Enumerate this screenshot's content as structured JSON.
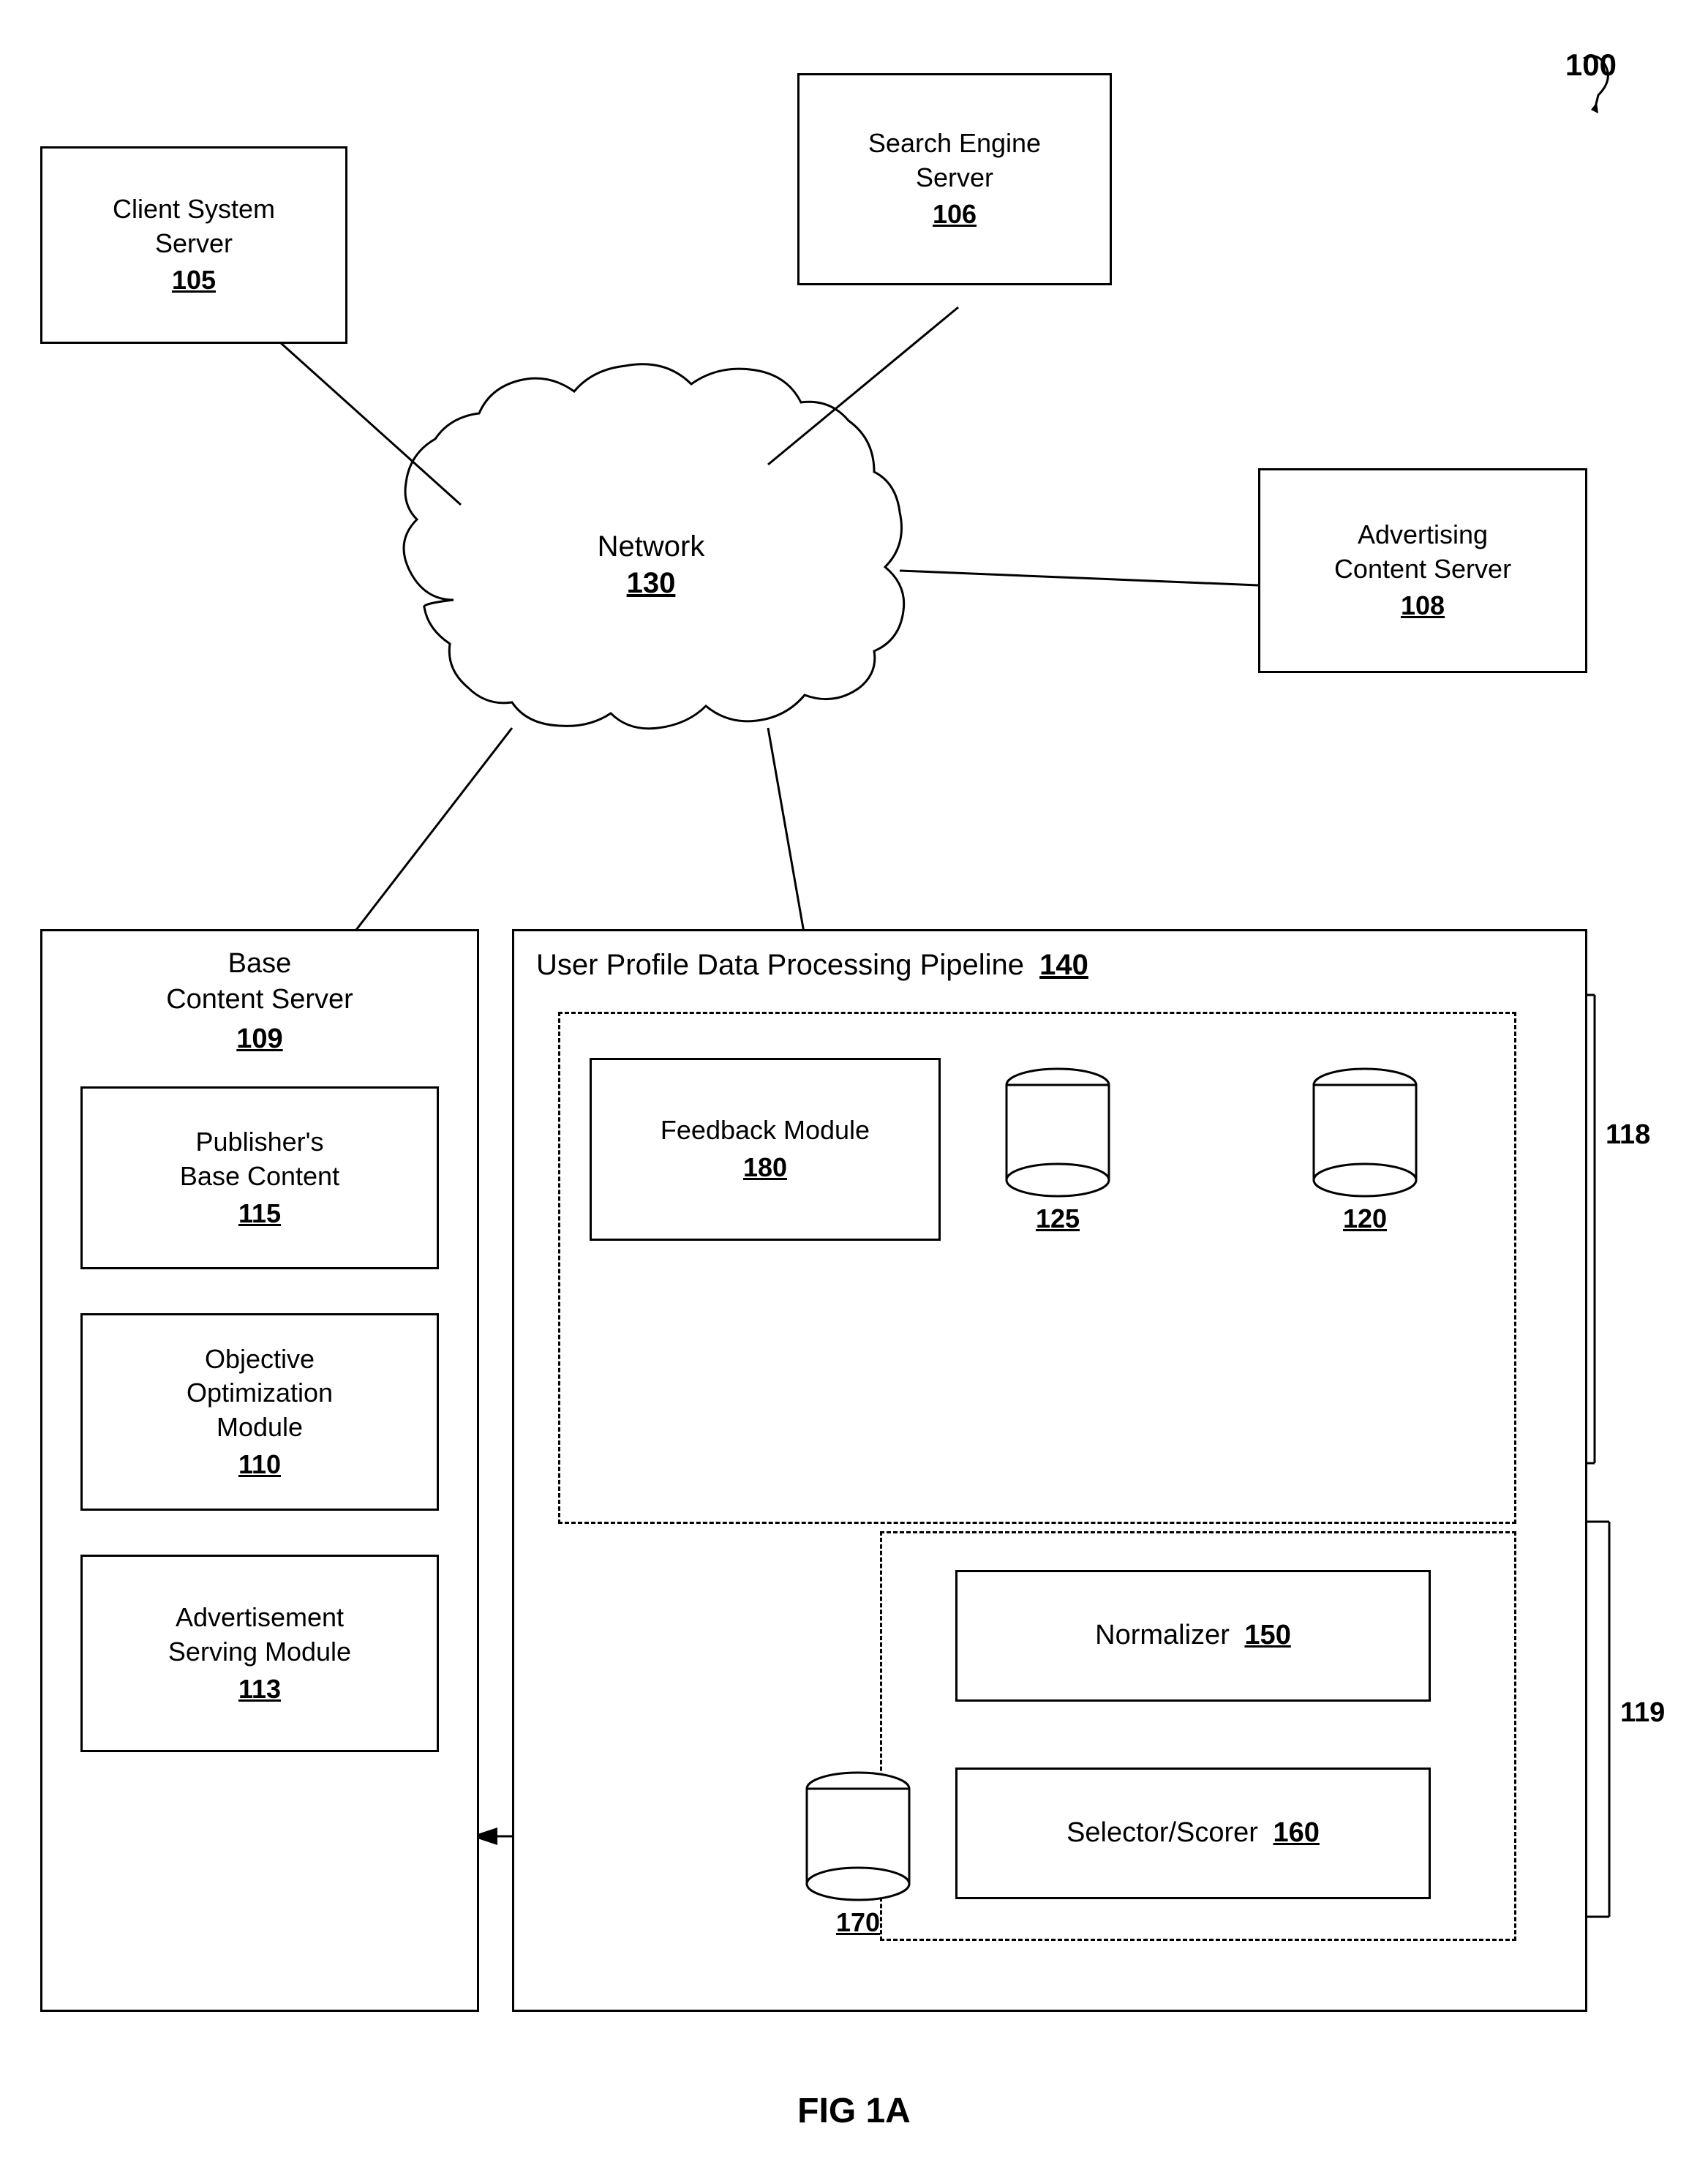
{
  "figure": {
    "label": "FIG 1A",
    "ref_number": "100"
  },
  "nodes": {
    "search_engine_server": {
      "label": "Search Engine\nServer",
      "id": "106"
    },
    "client_system_server": {
      "label": "Client System\nServer",
      "id": "105"
    },
    "advertising_content_server": {
      "label": "Advertising\nContent Server",
      "id": "108"
    },
    "network": {
      "label": "Network",
      "id": "130"
    },
    "base_content_server": {
      "label": "Base\nContent Server",
      "id": "109"
    },
    "publishers_base_content": {
      "label": "Publisher's\nBase Content",
      "id": "115"
    },
    "objective_optimization_module": {
      "label": "Objective\nOptimization\nModule",
      "id": "110"
    },
    "advertisement_serving_module": {
      "label": "Advertisement\nServing Module",
      "id": "113"
    },
    "pipeline": {
      "label": "User Profile Data Processing Pipeline",
      "id": "140"
    },
    "feedback_module": {
      "label": "Feedback Module",
      "id": "180"
    },
    "db_125": {
      "id": "125"
    },
    "db_120": {
      "id": "120"
    },
    "db_170": {
      "id": "170"
    },
    "normalizer": {
      "label": "Normalizer",
      "id": "150"
    },
    "selector_scorer": {
      "label": "Selector/Scorer",
      "id": "160"
    },
    "ref_118": "118",
    "ref_119": "119"
  }
}
